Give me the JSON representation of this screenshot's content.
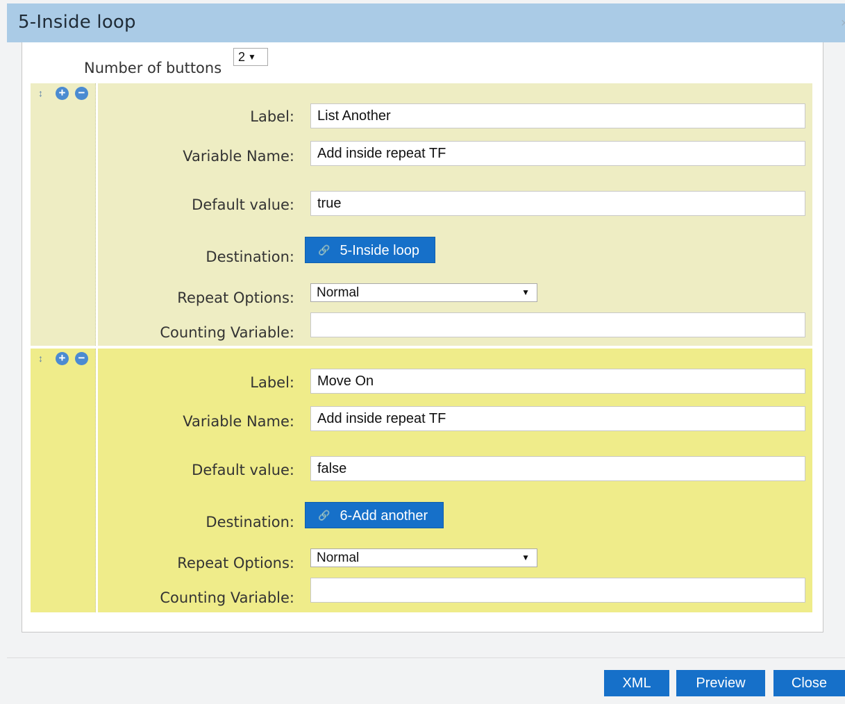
{
  "dialog": {
    "title": "5-Inside loop",
    "close_glyph": "×"
  },
  "number_of_buttons": {
    "label": "Number of buttons",
    "value": "2",
    "arrow": "▼"
  },
  "icons": {
    "move": "↕",
    "plus": "+",
    "minus": "−",
    "link": "🔗",
    "dropdown": "▼"
  },
  "buttons": [
    {
      "label_caption": "Label:",
      "label_value": "List Another",
      "variable_caption": "Variable Name:",
      "variable_value": "Add inside repeat TF",
      "default_caption": "Default value:",
      "default_value": "true",
      "destination_caption": "Destination:",
      "destination_value": "5-Inside loop",
      "repeat_caption": "Repeat Options:",
      "repeat_value": "Normal",
      "counting_caption": "Counting Variable:",
      "counting_value": ""
    },
    {
      "label_caption": "Label:",
      "label_value": "Move On",
      "variable_caption": "Variable Name:",
      "variable_value": "Add inside repeat TF",
      "default_caption": "Default value:",
      "default_value": "false",
      "destination_caption": "Destination:",
      "destination_value": "6-Add another",
      "repeat_caption": "Repeat Options:",
      "repeat_value": "Normal",
      "counting_caption": "Counting Variable:",
      "counting_value": ""
    }
  ],
  "footer": {
    "xml_label": "XML",
    "preview_label": "Preview",
    "close_label": "Close"
  },
  "colors": {
    "title_bar": "#aacbe6",
    "panel_1": "#eeedc3",
    "panel_2": "#efec8a",
    "primary_button": "#1670c9"
  }
}
